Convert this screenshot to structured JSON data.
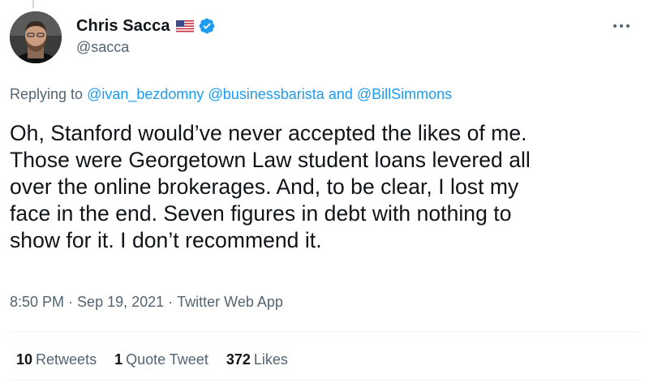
{
  "tweet": {
    "author": {
      "display_name": "Chris Sacca",
      "handle": "@sacca",
      "flag_icon": "us-flag-icon",
      "verified_icon": "verified-badge-icon"
    },
    "more_icon": "more-options-icon",
    "reply_to": {
      "prefix": "Replying to",
      "mention_1": "@ivan_bezdomny",
      "mention_2": "@businessbarista",
      "conjunction": "and",
      "mention_3": "@BillSimmons"
    },
    "text": "Oh, Stanford would’ve never accepted the likes of me.\nThose were Georgetown Law student loans levered all\nover the online brokerages. And, to be clear, I lost my\nface in the end. Seven figures in debt with nothing to\nshow for it. I don’t recommend it.",
    "time": "8:50 PM",
    "date": "Sep 19, 2021",
    "source": "Twitter Web App",
    "separator": "·"
  },
  "stats": {
    "retweets_count": "10",
    "retweets_label": "Retweets",
    "quotes_count": "1",
    "quotes_label": "Quote Tweet",
    "likes_count": "372",
    "likes_label": "Likes"
  },
  "colors": {
    "link": "#1d9bf0",
    "secondary_text": "#536471",
    "primary_text": "#0f1419",
    "verified": "#1d9bf0"
  }
}
